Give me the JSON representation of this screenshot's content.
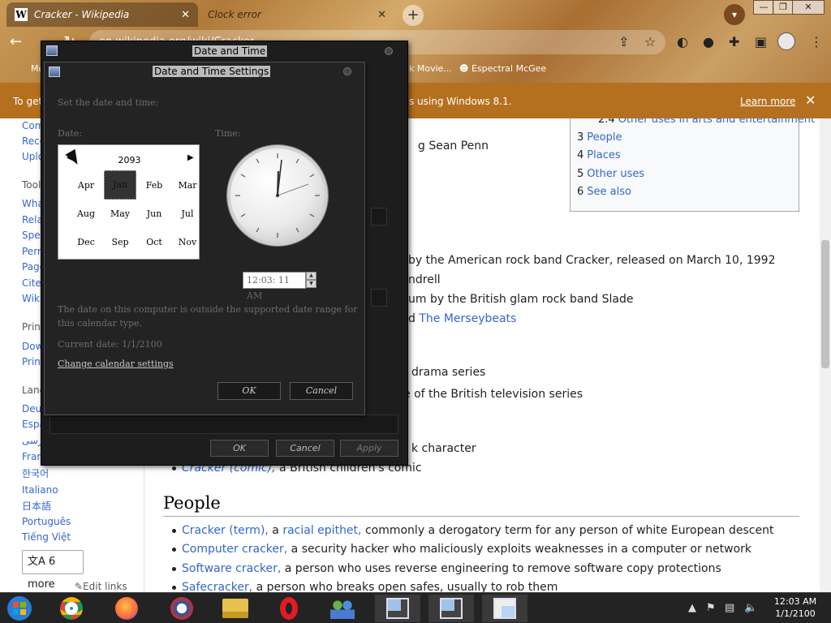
{
  "browser": {
    "tabs": [
      {
        "title": "Cracker - Wikipedia",
        "favicon": "W",
        "close": "✕"
      },
      {
        "title": "Clock error",
        "close": "✕"
      }
    ],
    "new_tab": "+",
    "tab_search": "▾",
    "window_controls": {
      "minimize": "—",
      "maximize": "❐",
      "close": "✕"
    },
    "address": "en.wikipedia.org/wiki/Cracker",
    "bookmarks": [
      {
        "label": "Mo"
      },
      {
        "label": "k Movie..."
      },
      {
        "label": "Espectral McGee"
      }
    ],
    "infobar": {
      "left_text": "To get",
      "right_text": "s using Windows 8.1.",
      "learn_more": "Learn more",
      "close": "✕"
    }
  },
  "wiki": {
    "sidebar": {
      "items": [
        {
          "label": "Com",
          "head": false
        },
        {
          "label": "Rece",
          "head": false
        },
        {
          "label": "Uplo",
          "head": false
        },
        {
          "label": "Tool",
          "head": true
        },
        {
          "label": "Wha",
          "head": false
        },
        {
          "label": "Rela",
          "head": false
        },
        {
          "label": "Spec",
          "head": false
        },
        {
          "label": "Perr",
          "head": false
        },
        {
          "label": "Page",
          "head": false
        },
        {
          "label": "Cite",
          "head": false
        },
        {
          "label": "Wiki",
          "head": false
        },
        {
          "label": "Print",
          "head": true
        },
        {
          "label": "Dow",
          "head": false
        },
        {
          "label": "Print",
          "head": false
        },
        {
          "label": "Lang",
          "head": true
        },
        {
          "label": "Deut",
          "head": false
        },
        {
          "label": "Espa",
          "head": false
        },
        {
          "label": "فارسی",
          "head": false
        },
        {
          "label": "Fran",
          "head": false
        },
        {
          "label": "한국어",
          "head": false
        },
        {
          "label": "Italiano",
          "head": false
        },
        {
          "label": "日本語",
          "head": false
        },
        {
          "label": "Português",
          "head": false
        },
        {
          "label": "Tiếng Việt",
          "head": false
        }
      ],
      "more_languages": "6 more",
      "edit_links": "Edit links"
    },
    "toc": {
      "items": [
        {
          "num": "2.4",
          "label": "Other uses in arts and entertainment"
        },
        {
          "num": "3",
          "label": "People"
        },
        {
          "num": "4",
          "label": "Places"
        },
        {
          "num": "5",
          "label": "Other uses"
        },
        {
          "num": "6",
          "label": "See also"
        }
      ]
    },
    "content": {
      "lines": [
        {
          "text": "g Sean Penn"
        },
        {
          "text": "by the American rock band Cracker, released on March 10, 1992"
        },
        {
          "text": "ndrell"
        },
        {
          "text": "um by the British glam rock band Slade"
        },
        {
          "text": "d ",
          "link": "The Merseybeats"
        },
        {
          "text": "drama series"
        },
        {
          "text": "e of the British television series"
        },
        {
          "text": "k character"
        }
      ],
      "cracker_comic_link": "Cracker (comic),",
      "cracker_comic_rest": " a British children's comic",
      "section_people": "People",
      "people_items": [
        {
          "link": "Cracker (term),",
          "link2": "racial epithet,",
          "pre": " a ",
          "rest": " commonly a derogatory term for any person of white European descent"
        },
        {
          "link": "Computer cracker,",
          "rest": " a security hacker who maliciously exploits weaknesses in a computer or network"
        },
        {
          "link": "Software cracker,",
          "rest": " a person who uses reverse engineering to remove software copy protections"
        },
        {
          "link": "Safecracker,",
          "rest": " a person who breaks open safes, usually to rob them"
        }
      ]
    }
  },
  "dialog_outer": {
    "title": "Date and Time",
    "buttons": {
      "ok": "OK",
      "cancel": "Cancel",
      "apply": "Apply"
    }
  },
  "dialog_inner": {
    "title": "Date and Time Settings",
    "instruction": "Set the date and time:",
    "date_label": "Date:",
    "time_label": "Time:",
    "calendar": {
      "year": "2093",
      "months": [
        "Apr",
        "Jan",
        "Feb",
        "Mar",
        "Aug",
        "May",
        "Jun",
        "Jul",
        "Dec",
        "Sep",
        "Oct",
        "Nov"
      ],
      "selected": "Jan",
      "prev": "◀",
      "next": "▶"
    },
    "time_value": "12:03: 11 AM",
    "spin_up": "▲",
    "spin_down": "▼",
    "warning": "The date on this computer is outside the supported date range for this calendar type.",
    "current_date": "Current date: 1/1/2100",
    "change_calendar": "Change calendar settings",
    "ok": "OK",
    "cancel": "Cancel"
  },
  "taskbar": {
    "time": "12:03 AM",
    "date": "1/1/2100",
    "tray_show_hidden": "▲"
  },
  "colors": {
    "wiki_link": "#3366cc",
    "infobar": "#b5701f",
    "dialog_bg": "#232323"
  }
}
